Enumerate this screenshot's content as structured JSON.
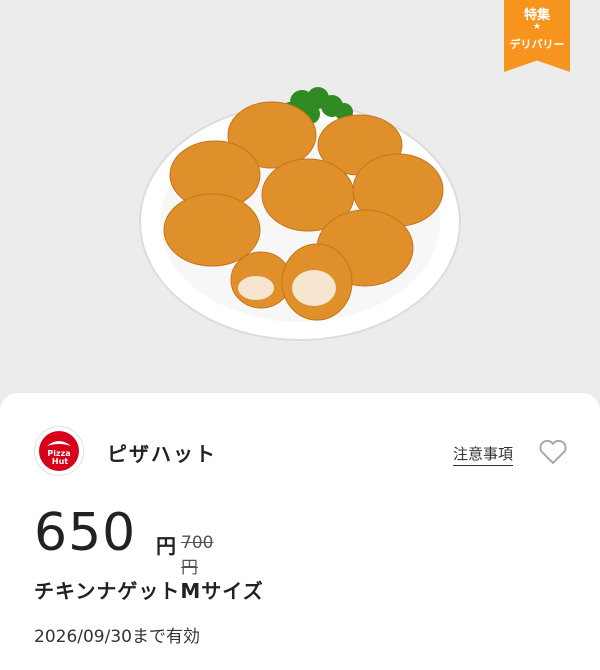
{
  "ribbon": {
    "line1": "特集",
    "line2": "デリバリー",
    "color": "#f7941d"
  },
  "image": {
    "subject": "chicken-nuggets-plate"
  },
  "shop": {
    "name": "ピザハット",
    "logo_text": "Pizza Hut",
    "logo_color": "#d7001b"
  },
  "links": {
    "notes": "注意事項"
  },
  "icons": {
    "favorite": "heart-outline-icon"
  },
  "price": {
    "current": "650",
    "yen": "円",
    "original": "700円"
  },
  "product": {
    "name": "チキンナゲットMサイズ"
  },
  "validity": {
    "text": "2026/09/30まで有効"
  }
}
